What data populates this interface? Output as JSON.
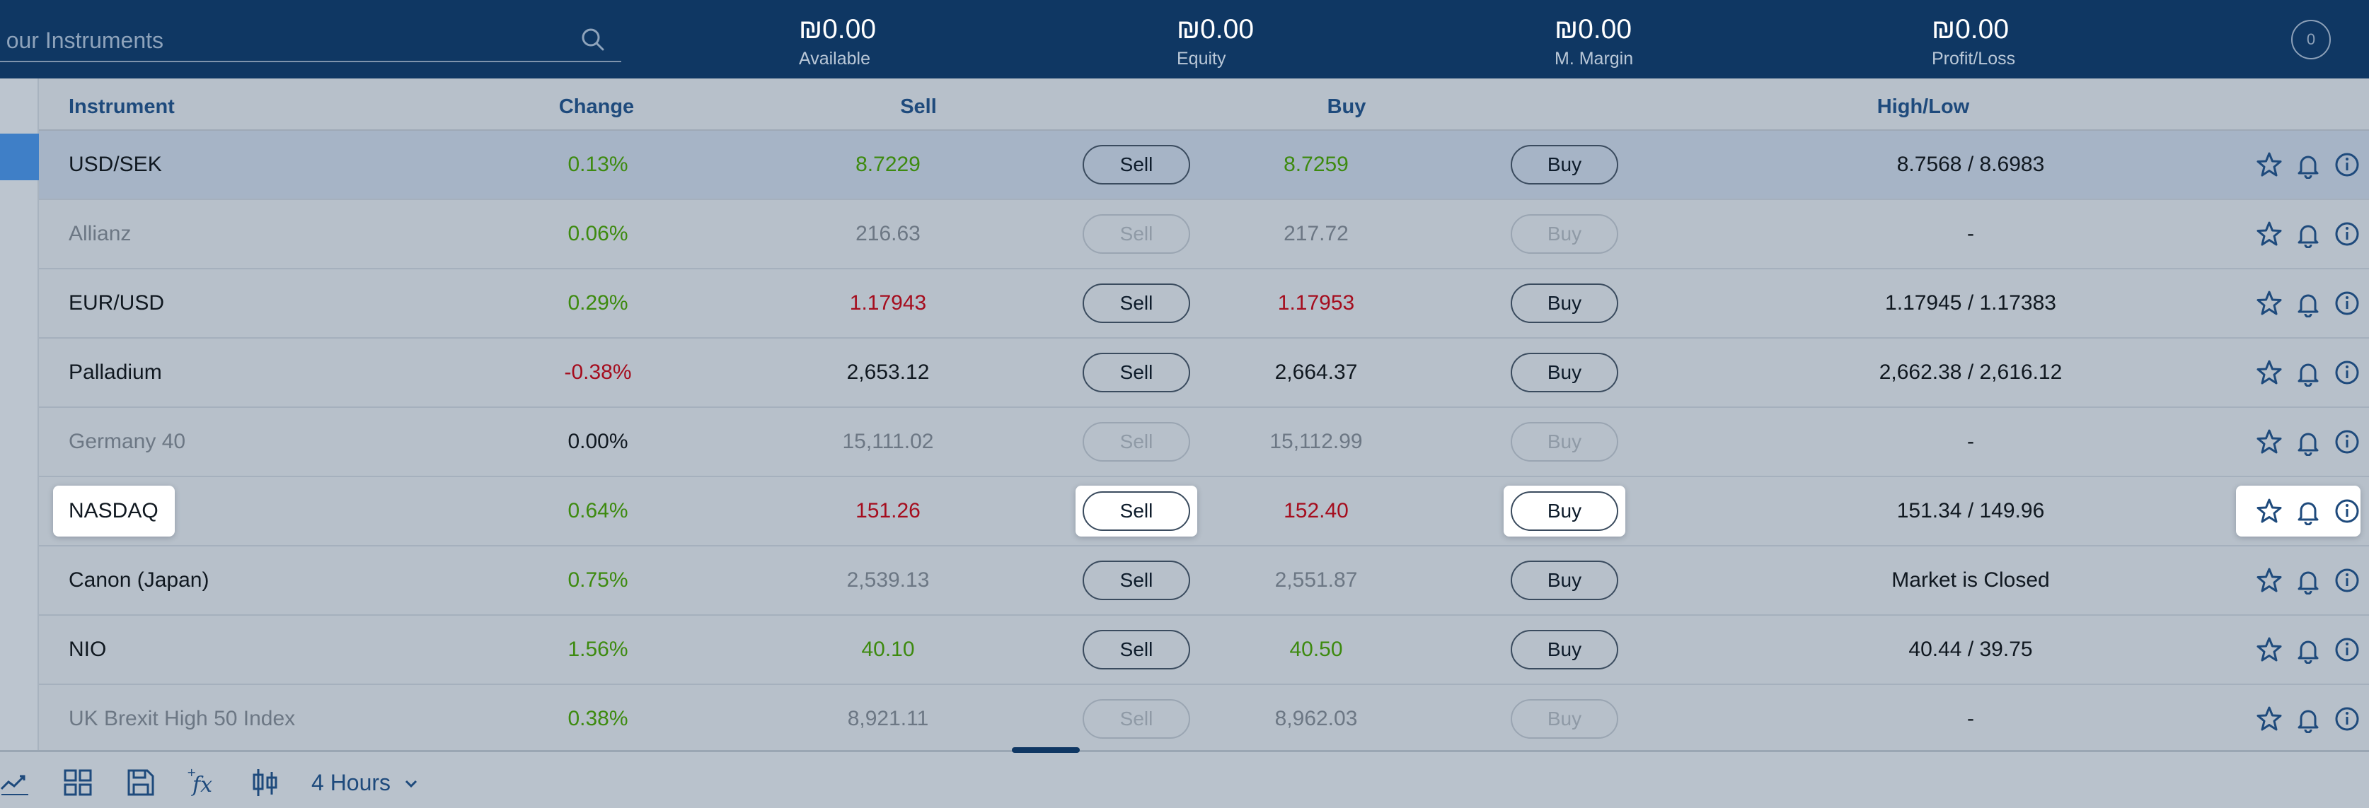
{
  "search": {
    "placeholder": "h our Instruments",
    "icon": "search-icon"
  },
  "account_stats": [
    {
      "value": "₪0.00",
      "label": "Available"
    },
    {
      "value": "₪0.00",
      "label": "Equity"
    },
    {
      "value": "₪0.00",
      "label": "M. Margin"
    },
    {
      "value": "₪0.00",
      "label": "Profit/Loss"
    }
  ],
  "account_badge": "0",
  "columns": {
    "instrument": "Instrument",
    "change": "Change",
    "sell": "Sell",
    "buy": "Buy",
    "highlow": "High/Low"
  },
  "rows": [
    {
      "name": "USD/SEK",
      "change": "0.13%",
      "sell": "8.7229",
      "buy": "8.7259",
      "highlow": "8.7568 / 8.6983",
      "sell_btn": "Sell",
      "buy_btn": "Buy",
      "change_tone": "pos",
      "price_tone": "pos",
      "enabled": true,
      "selected": true
    },
    {
      "name": "Allianz",
      "change": "0.06%",
      "sell": "216.63",
      "buy": "217.72",
      "highlow": "-",
      "sell_btn": "Sell",
      "buy_btn": "Buy",
      "change_tone": "pos",
      "price_tone": "muted",
      "enabled": false
    },
    {
      "name": "EUR/USD",
      "change": "0.29%",
      "sell": "1.17943",
      "buy": "1.17953",
      "highlow": "1.17945 / 1.17383",
      "sell_btn": "Sell",
      "buy_btn": "Buy",
      "change_tone": "pos",
      "price_tone": "neg",
      "enabled": true
    },
    {
      "name": "Palladium",
      "change": "-0.38%",
      "sell": "2,653.12",
      "buy": "2,664.37",
      "highlow": "2,662.38 / 2,616.12",
      "sell_btn": "Sell",
      "buy_btn": "Buy",
      "change_tone": "neg",
      "price_tone": "dark",
      "enabled": true
    },
    {
      "name": "Germany 40",
      "change": "0.00%",
      "sell": "15,111.02",
      "buy": "15,112.99",
      "highlow": "-",
      "sell_btn": "Sell",
      "buy_btn": "Buy",
      "change_tone": "neu",
      "price_tone": "muted",
      "enabled": false
    },
    {
      "name": "NASDAQ",
      "change": "0.64%",
      "sell": "151.26",
      "buy": "152.40",
      "highlow": "151.34 / 149.96",
      "sell_btn": "Sell",
      "buy_btn": "Buy",
      "change_tone": "pos",
      "price_tone": "neg",
      "enabled": true,
      "popout": true
    },
    {
      "name": "Canon (Japan)",
      "change": "0.75%",
      "sell": "2,539.13",
      "buy": "2,551.87",
      "highlow": "Market is Closed",
      "sell_btn": "Sell",
      "buy_btn": "Buy",
      "change_tone": "pos",
      "price_tone": "muted",
      "enabled": true
    },
    {
      "name": "NIO",
      "change": "1.56%",
      "sell": "40.10",
      "buy": "40.50",
      "highlow": "40.44 / 39.75",
      "sell_btn": "Sell",
      "buy_btn": "Buy",
      "change_tone": "pos",
      "price_tone": "pos",
      "enabled": true
    },
    {
      "name": "UK Brexit High 50 Index",
      "change": "0.38%",
      "sell": "8,921.11",
      "buy": "8,962.03",
      "highlow": "-",
      "sell_btn": "Sell",
      "buy_btn": "Buy",
      "change_tone": "pos",
      "price_tone": "muted",
      "enabled": false
    }
  ],
  "row_icons": [
    "star-icon",
    "bell-icon",
    "info-icon"
  ],
  "toolbar": {
    "timeframe": "4 Hours",
    "icons": [
      "trend-icon",
      "grid-layout-icon",
      "save-icon",
      "function-icon",
      "candlestick-icon"
    ]
  },
  "colors": {
    "topbar": "#0f3763",
    "positive": "#3d8a0f",
    "negative": "#a50d1e",
    "accent": "#1e4a7c"
  }
}
